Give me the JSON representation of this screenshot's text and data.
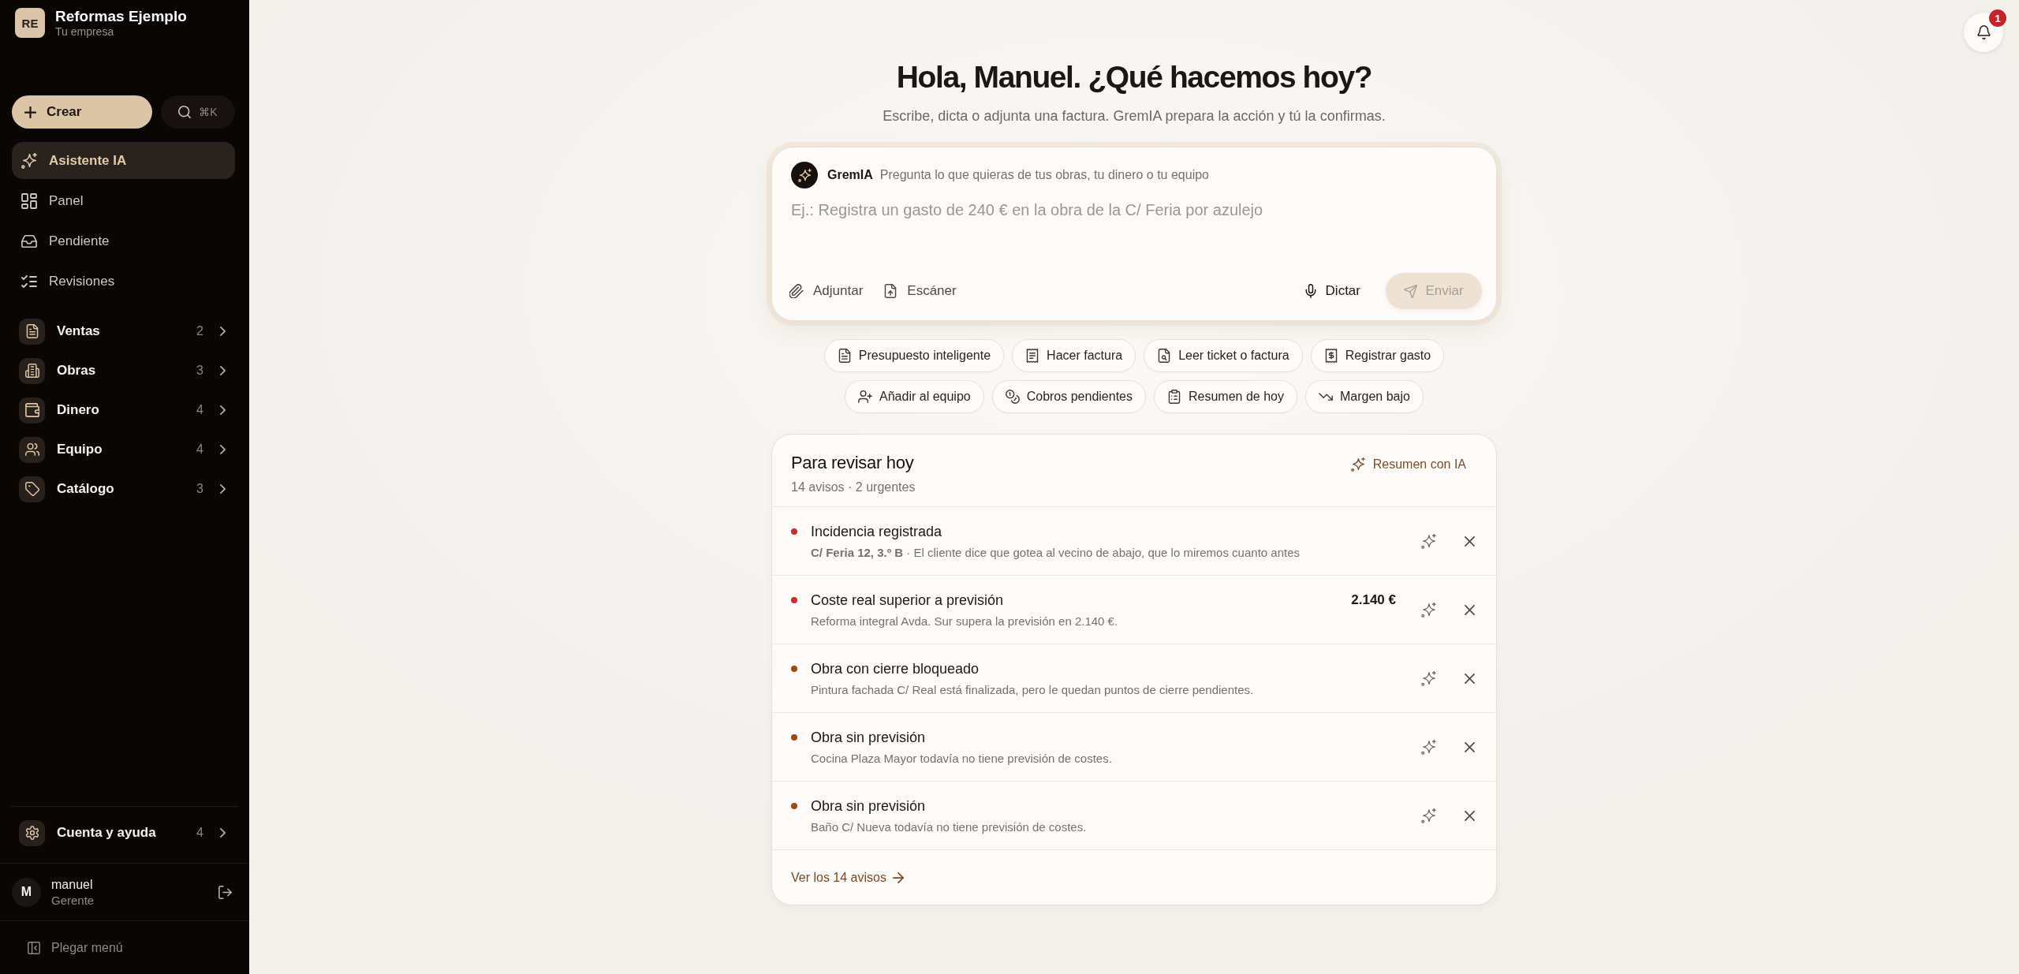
{
  "sidebar": {
    "company": {
      "initials": "RE",
      "name": "Reformas Ejemplo",
      "tagline": "Tu empresa"
    },
    "create_button": {
      "label": "Crear"
    },
    "search_button": {
      "shortcut": "⌘K"
    },
    "nav_items": [
      {
        "label": "Asistente IA",
        "selected": true
      },
      {
        "label": "Panel",
        "selected": false
      },
      {
        "label": "Pendiente",
        "selected": false
      },
      {
        "label": "Revisiones",
        "selected": false
      }
    ],
    "groups": [
      {
        "label": "Ventas",
        "count": "2"
      },
      {
        "label": "Obras",
        "count": "3"
      },
      {
        "label": "Dinero",
        "count": "4"
      },
      {
        "label": "Equipo",
        "count": "4"
      },
      {
        "label": "Catálogo",
        "count": "3"
      }
    ],
    "account_group": {
      "label": "Cuenta y ayuda",
      "count": "4"
    },
    "user": {
      "initial": "M",
      "name": "manuel",
      "role": "Gerente"
    },
    "collapse_button": {
      "label": "Plegar menú"
    }
  },
  "notifications": {
    "badge": "1"
  },
  "greeting": {
    "title": "Hola, Manuel. ¿Qué hacemos hoy?",
    "subtitle": "Escribe, dicta o adjunta una factura. GremIA prepara la acción y tú la confirmas."
  },
  "composer": {
    "assistant_name": "GremIA",
    "assistant_hint": "Pregunta lo que quieras de tus obras, tu dinero o tu equipo",
    "placeholder": "Ej.: Registra un gasto de 240 € en la obra de la C/ Feria por azulejo",
    "attach_button": {
      "label": "Adjuntar"
    },
    "scan_button": {
      "label": "Escáner"
    },
    "dictate_button": {
      "label": "Dictar"
    },
    "send_button": {
      "label": "Enviar",
      "disabled": true
    }
  },
  "quick_action_rows": [
    {
      "actions": [
        {
          "label": "Presupuesto inteligente"
        },
        {
          "label": "Hacer factura"
        },
        {
          "label": "Leer ticket o factura"
        },
        {
          "label": "Registrar gasto"
        }
      ]
    },
    {
      "actions": [
        {
          "label": "Añadir al equipo"
        },
        {
          "label": "Cobros pendientes"
        },
        {
          "label": "Resumen de hoy"
        },
        {
          "label": "Margen bajo"
        }
      ]
    }
  ],
  "review": {
    "title": "Para revisar hoy",
    "summary": "14 avisos · 2 urgentes",
    "ai_button": {
      "label": "Resumen con IA"
    },
    "items": [
      {
        "title": "Incidencia registrada",
        "detail": "**C/ Feria 12, 3.º B** · El cliente dice que gotea al vecino de abajo, que lo miremos cuanto antes",
        "color": "#c62f2f"
      },
      {
        "title": "Coste real superior a previsión",
        "detail": "Reforma integral Avda. Sur supera la previsión en 2.140 €.",
        "amount": "2.140 €",
        "color": "#c62f2f"
      },
      {
        "title": "Obra con cierre bloqueado",
        "detail": "Pintura fachada C/ Real está finalizada, pero le quedan puntos de cierre pendientes.",
        "color": "#9a4a12"
      },
      {
        "title": "Obra sin previsión",
        "detail": "Cocina Plaza Mayor todavía no tiene previsión de costes.",
        "color": "#9a4a12"
      },
      {
        "title": "Obra sin previsión",
        "detail": "Baño C/ Nueva todavía no tiene previsión de costes.",
        "color": "#9a4a12"
      }
    ],
    "footer_link": {
      "label": "Ver los 14 avisos"
    }
  }
}
